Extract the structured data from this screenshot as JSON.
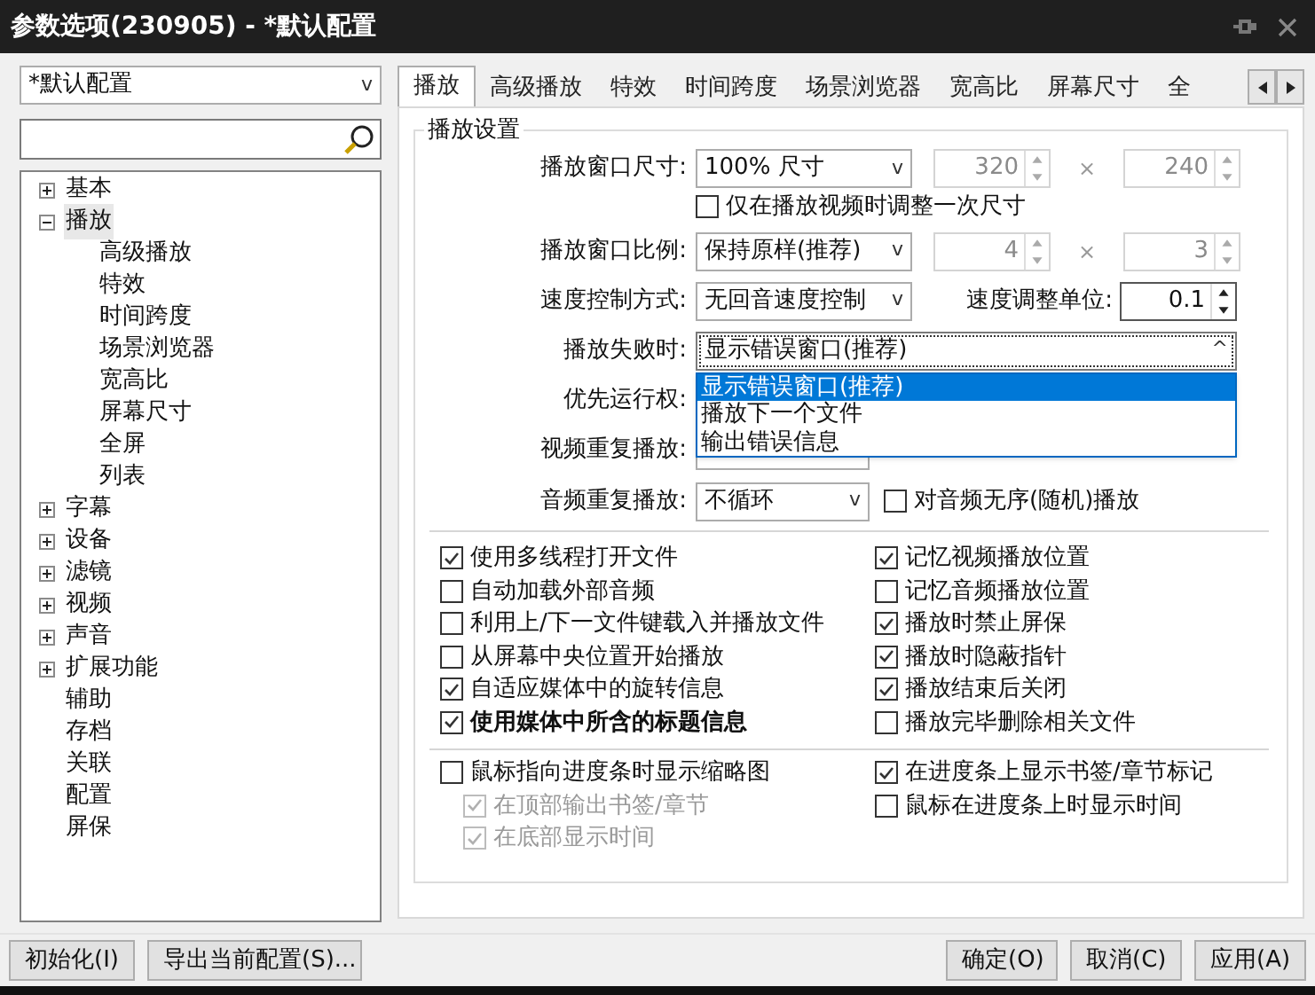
{
  "window": {
    "title": "参数选项(230905) - *默认配置"
  },
  "profile_select": {
    "value": "*默认配置",
    "arrow": "v"
  },
  "tree": [
    {
      "label": "基本",
      "kind": "group",
      "expanded": false,
      "selected": false
    },
    {
      "label": "播放",
      "kind": "group",
      "expanded": true,
      "selected": true,
      "children": [
        {
          "label": "高级播放",
          "selected": false
        },
        {
          "label": "特效",
          "selected": false
        },
        {
          "label": "时间跨度",
          "selected": false
        },
        {
          "label": "场景浏览器",
          "selected": false
        },
        {
          "label": "宽高比",
          "selected": false
        },
        {
          "label": "屏幕尺寸",
          "selected": false
        },
        {
          "label": "全屏",
          "selected": false
        },
        {
          "label": "列表",
          "selected": false
        }
      ]
    },
    {
      "label": "字幕",
      "kind": "group",
      "expanded": false,
      "selected": false
    },
    {
      "label": "设备",
      "kind": "group",
      "expanded": false,
      "selected": false
    },
    {
      "label": "滤镜",
      "kind": "group",
      "expanded": false,
      "selected": false
    },
    {
      "label": "视频",
      "kind": "group",
      "expanded": false,
      "selected": false
    },
    {
      "label": "声音",
      "kind": "group",
      "expanded": false,
      "selected": false
    },
    {
      "label": "扩展功能",
      "kind": "group",
      "expanded": false,
      "selected": false
    },
    {
      "label": "辅助",
      "kind": "leaf",
      "selected": false
    },
    {
      "label": "存档",
      "kind": "leaf",
      "selected": false
    },
    {
      "label": "关联",
      "kind": "leaf",
      "selected": false
    },
    {
      "label": "配置",
      "kind": "leaf",
      "selected": false
    },
    {
      "label": "屏保",
      "kind": "leaf",
      "selected": false
    }
  ],
  "tabs": [
    {
      "label": "播放",
      "selected": true
    },
    {
      "label": "高级播放",
      "selected": false
    },
    {
      "label": "特效",
      "selected": false
    },
    {
      "label": "时间跨度",
      "selected": false
    },
    {
      "label": "场景浏览器",
      "selected": false
    },
    {
      "label": "宽高比",
      "selected": false
    },
    {
      "label": "屏幕尺寸",
      "selected": false
    },
    {
      "label": "全",
      "selected": false
    }
  ],
  "group_title": "播放设置",
  "size_row": {
    "label": "播放窗口尺寸:",
    "combo": "100% 尺寸",
    "arrow": "v",
    "first": "320",
    "sep": "×",
    "second": "240",
    "disabled": true
  },
  "once_checkbox": {
    "label": "仅在播放视频时调整一次尺寸",
    "checked": false
  },
  "ratio_row": {
    "label": "播放窗口比例:",
    "combo": "保持原样(推荐)",
    "arrow": "v",
    "first": "4",
    "sep": "×",
    "second": "3",
    "disabled": true
  },
  "speed_row": {
    "label": "速度控制方式:",
    "combo": "无回音速度控制",
    "arrow": "v",
    "unit_label": "速度调整单位:",
    "unit": "0.1",
    "disabled": false
  },
  "fail_row": {
    "label": "播放失败时:",
    "combo": "显示错误窗口(推荐)",
    "arrow": "^",
    "expanded": true,
    "options": [
      {
        "label": "显示错误窗口(推荐)",
        "selected": true
      },
      {
        "label": "播放下一个文件",
        "selected": false
      },
      {
        "label": "输出错误信息",
        "selected": false
      }
    ]
  },
  "priority_row": {
    "label": "优先运行权:"
  },
  "video_repeat": {
    "label": "视频重复播放:"
  },
  "audio_repeat": {
    "label": "音频重复播放:",
    "combo": "不循环",
    "arrow": "v",
    "checkbox": {
      "label": "对音频无序(随机)播放",
      "checked": false
    }
  },
  "left_options": [
    {
      "label": "使用多线程打开文件",
      "checked": true,
      "bold": false
    },
    {
      "label": "自动加载外部音频",
      "checked": false,
      "bold": false
    },
    {
      "label": "利用上/下一文件键载入并播放文件",
      "checked": false,
      "bold": false
    },
    {
      "label": "从屏幕中央位置开始播放",
      "checked": false,
      "bold": false
    },
    {
      "label": "自适应媒体中的旋转信息",
      "checked": true,
      "bold": false
    },
    {
      "label": "使用媒体中所含的标题信息",
      "checked": true,
      "bold": true
    }
  ],
  "right_options": [
    {
      "label": "记忆视频播放位置",
      "checked": true
    },
    {
      "label": "记忆音频播放位置",
      "checked": false
    },
    {
      "label": "播放时禁止屏保",
      "checked": true
    },
    {
      "label": "播放时隐蔽指针",
      "checked": true
    },
    {
      "label": "播放结束后关闭",
      "checked": true
    },
    {
      "label": "播放完毕删除相关文件",
      "checked": false
    }
  ],
  "progress_left": [
    {
      "label": "鼠标指向进度条时显示缩略图",
      "checked": false,
      "disabled": false,
      "children": [
        {
          "label": "在顶部输出书签/章节",
          "checked": true,
          "disabled": true
        },
        {
          "label": "在底部显示时间",
          "checked": true,
          "disabled": true
        }
      ]
    }
  ],
  "progress_right": [
    {
      "label": "在进度条上显示书签/章节标记",
      "checked": true,
      "disabled": false
    },
    {
      "label": "鼠标在进度条上时显示时间",
      "checked": false,
      "disabled": false
    }
  ],
  "left_buttons": [
    "初始化(I)",
    "导出当前配置(S)..."
  ],
  "dialog_buttons": [
    "确定(O)",
    "取消(C)",
    "应用(A)"
  ]
}
